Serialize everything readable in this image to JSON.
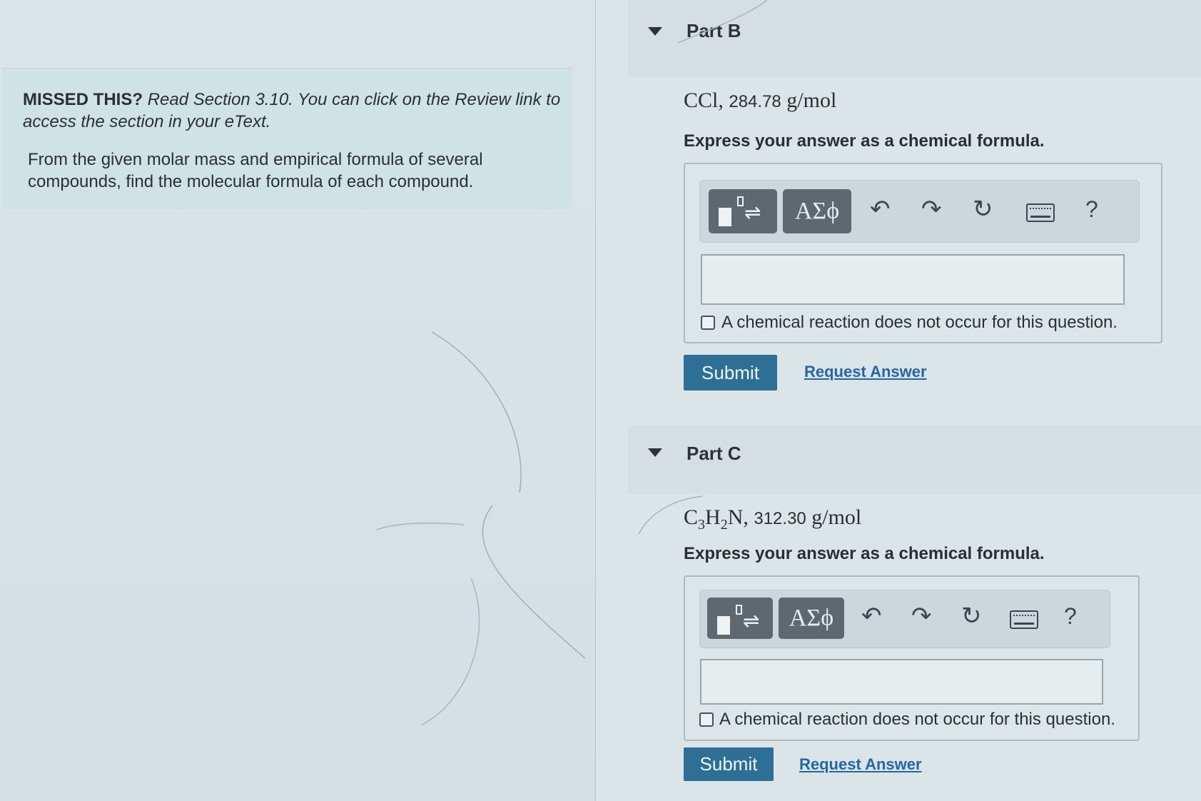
{
  "hint": {
    "missed_label": "MISSED THIS?",
    "missed_text": "Read Section 3.10. You can click on the Review link to access the section in your eText.",
    "instruction": "From the given molar mass and empirical formula of several compounds, find the molecular formula of each compound."
  },
  "parts": [
    {
      "title": "Part B",
      "formula_main": "CCl, ",
      "formula_mass": "284.78",
      "formula_unit": " g/mol",
      "instruction": "Express your answer as a chemical formula.",
      "toolbar": {
        "greek_label": "ΑΣϕ",
        "undo_icon": "undo-icon",
        "redo_icon": "redo-icon",
        "reset_icon": "reset-icon",
        "keyboard_icon": "keyboard-icon",
        "help_label": "?"
      },
      "answer_value": "",
      "no_reaction_label": "A chemical reaction does not occur for this question.",
      "submit_label": "Submit",
      "request_label": "Request Answer"
    },
    {
      "title": "Part C",
      "formula_main": "C3H2N, ",
      "formula_mass": "312.30",
      "formula_unit": " g/mol",
      "instruction": "Express your answer as a chemical formula.",
      "toolbar": {
        "greek_label": "ΑΣϕ",
        "undo_icon": "undo-icon",
        "redo_icon": "redo-icon",
        "reset_icon": "reset-icon",
        "keyboard_icon": "keyboard-icon",
        "help_label": "?"
      },
      "answer_value": "",
      "no_reaction_label": "A chemical reaction does not occur for this question.",
      "submit_label": "Submit",
      "request_label": "Request Answer"
    }
  ],
  "colors": {
    "accent": "#2d6f95",
    "link": "#2466a6",
    "hint_bg": "#cfe3e3"
  }
}
